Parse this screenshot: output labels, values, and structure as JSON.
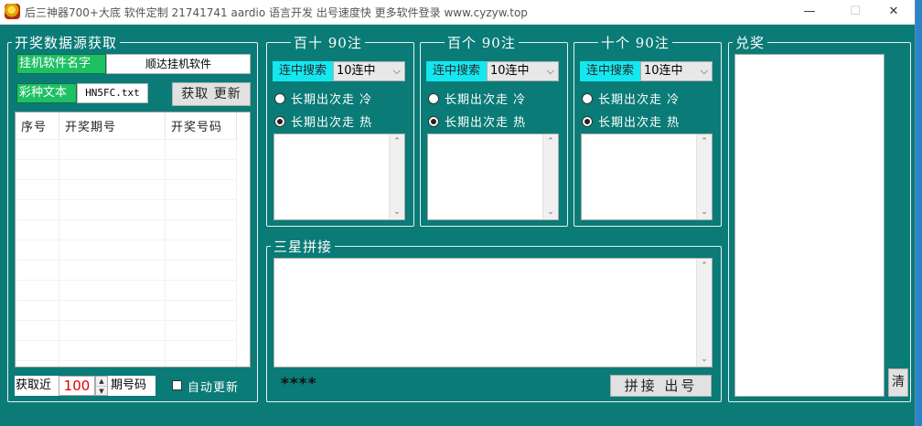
{
  "window": {
    "title": "后三神器700+大底 软件定制 21741741 aardio 语言开发 出号速度快 更多软件登录 www.cyzyw.top",
    "minimize": "—",
    "maximize": "☐",
    "close": "✕"
  },
  "fetch_panel": {
    "legend": "开奖数据源获取",
    "software_name_label": "挂机软件名字",
    "software_name_value": "顺达挂机软件",
    "lottery_text_label": "彩种文本",
    "lottery_text_value": "HN5FC.txt",
    "fetch_button": "获取 更新",
    "table_headers": [
      "序号",
      "开奖期号",
      "开奖号码"
    ],
    "fetch_recent_label": "获取近",
    "fetch_recent_count": "100",
    "periods_label": "期号码",
    "auto_update_label": "自动更新"
  },
  "groups": [
    {
      "legend": "百十 90注",
      "search_label": "连中搜索",
      "select_value": "10连中",
      "option_cold": "长期出次走 冷",
      "option_hot": "长期出次走 热",
      "selected": "hot"
    },
    {
      "legend": "百个 90注",
      "search_label": "连中搜索",
      "select_value": "10连中",
      "option_cold": "长期出次走 冷",
      "option_hot": "长期出次走 热",
      "selected": "hot"
    },
    {
      "legend": "十个 90注",
      "search_label": "连中搜索",
      "select_value": "10连中",
      "option_cold": "长期出次走 冷",
      "option_hot": "长期出次走 热",
      "selected": "hot"
    }
  ],
  "combine": {
    "legend": "三星拼接",
    "stars": "****",
    "button": "拼接 出号"
  },
  "prize": {
    "legend": "兑奖",
    "clear_button": "清"
  }
}
